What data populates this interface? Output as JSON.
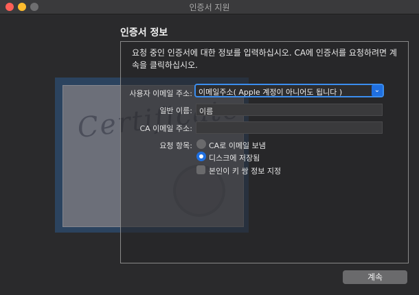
{
  "window": {
    "title": "인증서 지원"
  },
  "section": {
    "title": "인증서 정보"
  },
  "intro": "요청 중인 인증서에 대한 정보를 입력하십시오. CA에 인증서를 요청하려면 계속을 클릭하십시오.",
  "artwork": {
    "word": "Certificate"
  },
  "form": {
    "email_label": "사용자 이메일 주소:",
    "email_value": "이메일주소( Apple 계정이 아니어도 됩니다 )",
    "name_label": "일반 이름:",
    "name_value": "이름",
    "ca_label": "CA 이메일 주소:",
    "ca_value": "",
    "request_label": "요청 항목:",
    "options": [
      {
        "label": "CA로 이메일 보냄",
        "selected": false
      },
      {
        "label": "디스크에 저장됨",
        "selected": true
      }
    ],
    "key_pair_label": "본인이 키 쌍 정보 지정",
    "key_pair_checked": false
  },
  "buttons": {
    "continue": "계속"
  },
  "colors": {
    "accent": "#1f6fe0",
    "close": "#fe5f57",
    "minimize": "#febc2e"
  }
}
